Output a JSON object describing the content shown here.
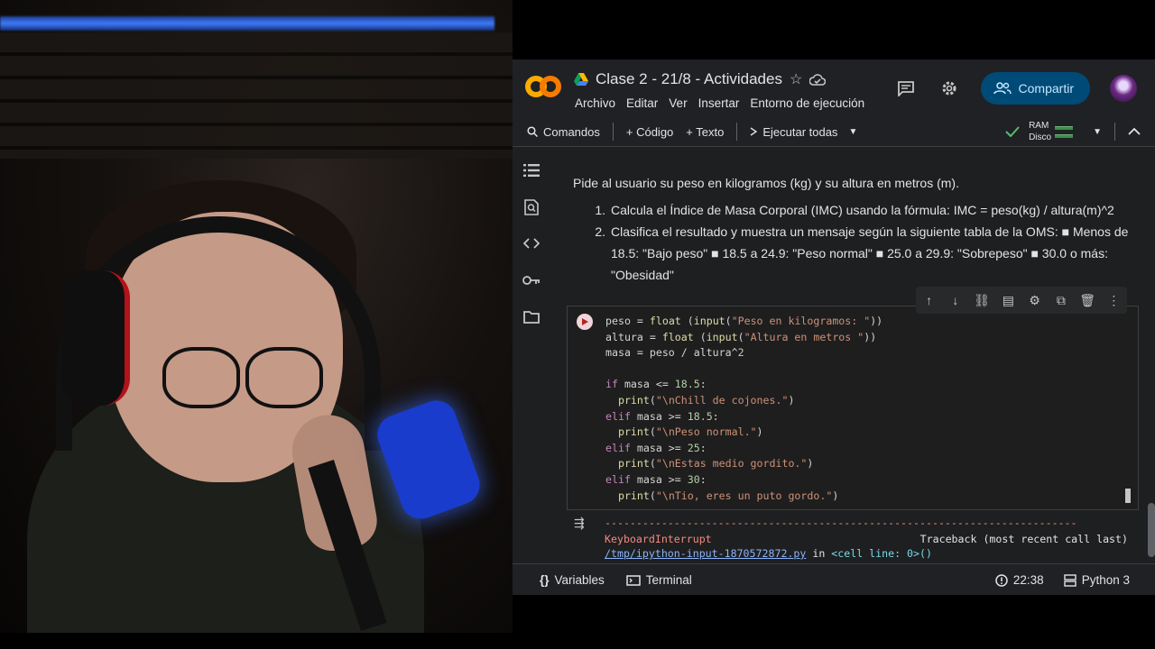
{
  "app": {
    "title": "Clase 2 - 21/8 - Actividades",
    "logo_text": "CO",
    "menu": [
      "Archivo",
      "Editar",
      "Ver",
      "Insertar",
      "Entorno de ejecución"
    ],
    "share_label": "Compartir"
  },
  "toolbar": {
    "commands_label": "Comandos",
    "add_code_label": "+ Código",
    "add_text_label": "+ Texto",
    "run_all_label": "Ejecutar todas",
    "ram_label": "RAM",
    "disk_label": "Disco"
  },
  "text_cell": {
    "paragraph": "Pide al usuario su peso en kilogramos (kg) y su altura en metros (m).",
    "steps": [
      {
        "num": "1.",
        "text": "Calcula el Índice de Masa Corporal (IMC) usando la fórmula: IMC = peso(kg) / altura(m)^2"
      },
      {
        "num": "2.",
        "text": "Clasifica el resultado y muestra un mensaje según la siguiente tabla de la OMS: ■ Menos de 18.5: \"Bajo peso\" ■ 18.5 a 24.9: \"Peso normal\" ■ 25.0 a 29.9: \"Sobrepeso\" ■ 30.0 o más: \"Obesidad\""
      }
    ]
  },
  "code_cell": {
    "lines": [
      "peso = float (input(\"Peso en kilogramos: \"))",
      "altura = float (input(\"Altura en metros \"))",
      "masa = peso / altura^2",
      "",
      "if masa <= 18.5:",
      "  print(\"\\nChill de cojones.\")",
      "elif masa >= 18.5:",
      "  print(\"\\nPeso normal.\")",
      "elif masa >= 25:",
      "  print(\"\\nEstas medio gordito.\")",
      "elif masa >= 30:",
      "  print(\"\\nTio, eres un puto gordo.\")"
    ]
  },
  "output": {
    "dashes": "---------------------------------------------------------------------------",
    "error_name": "KeyboardInterrupt",
    "traceback_label": "Traceback (most recent call last)",
    "file_link": "/tmp/ipython-input-1870572872.py",
    "in_word": " in ",
    "cell_ref": "<cell line: 0>()"
  },
  "statusbar": {
    "variables_label": "Variables",
    "terminal_label": "Terminal",
    "time": "22:38",
    "runtime": "Python 3"
  },
  "colors": {
    "accent_orange": "#f9ab00",
    "share_bg": "#004a77",
    "error_red": "#f28b82",
    "link_blue": "#8ab4f8"
  }
}
